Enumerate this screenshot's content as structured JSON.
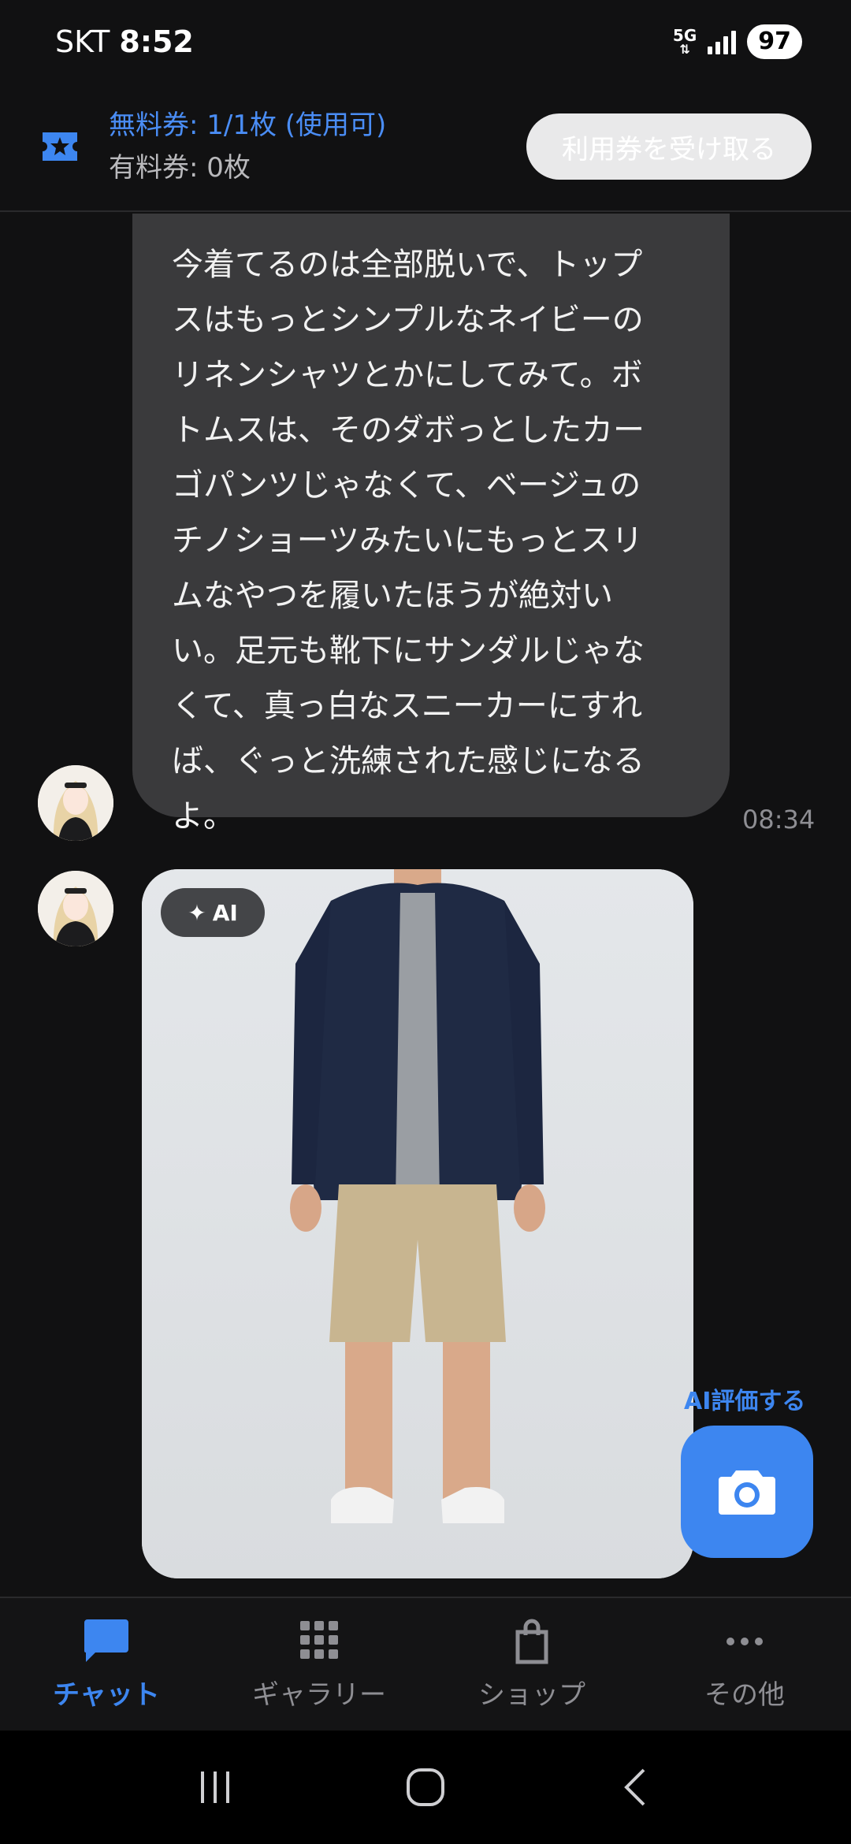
{
  "status_bar": {
    "carrier": "SKT",
    "time": "8:52",
    "network": "5G",
    "battery": "97"
  },
  "ticket": {
    "free_label": "無料券: 1/1枚 (使用可)",
    "paid_label": "有料券: 0枚",
    "receive_button": "利用券を受け取る"
  },
  "chat": {
    "message_text": "今着てるのは全部脱いで、トップ\nスはもっとシンプルなネイビーの\nリネンシャツとかにしてみて。ボ\nトムスは、そのダボっとしたカー\nゴパンツじゃなくて、ベージュの\nチノショーツみたいにもっとスリ\nムなやつを履いたほうが絶対い\nい。足元も靴下にサンダルじゃな\nくて、真っ白なスニーカーにすれ\nば、ぐっと洗練された感じになる\nよ。",
    "message_time": "08:34",
    "ai_badge": "AI",
    "ai_eval_label": "AI評価する"
  },
  "bottom_nav": {
    "items": [
      {
        "label": "チャット",
        "icon": "chat-bubble-icon",
        "active": true
      },
      {
        "label": "ギャラリー",
        "icon": "grid-icon",
        "active": false
      },
      {
        "label": "ショップ",
        "icon": "shopping-bag-icon",
        "active": false
      },
      {
        "label": "その他",
        "icon": "more-dots-icon",
        "active": false
      }
    ]
  },
  "colors": {
    "accent": "#3d86f0",
    "background": "#111112",
    "bubble": "#3a3a3c"
  }
}
